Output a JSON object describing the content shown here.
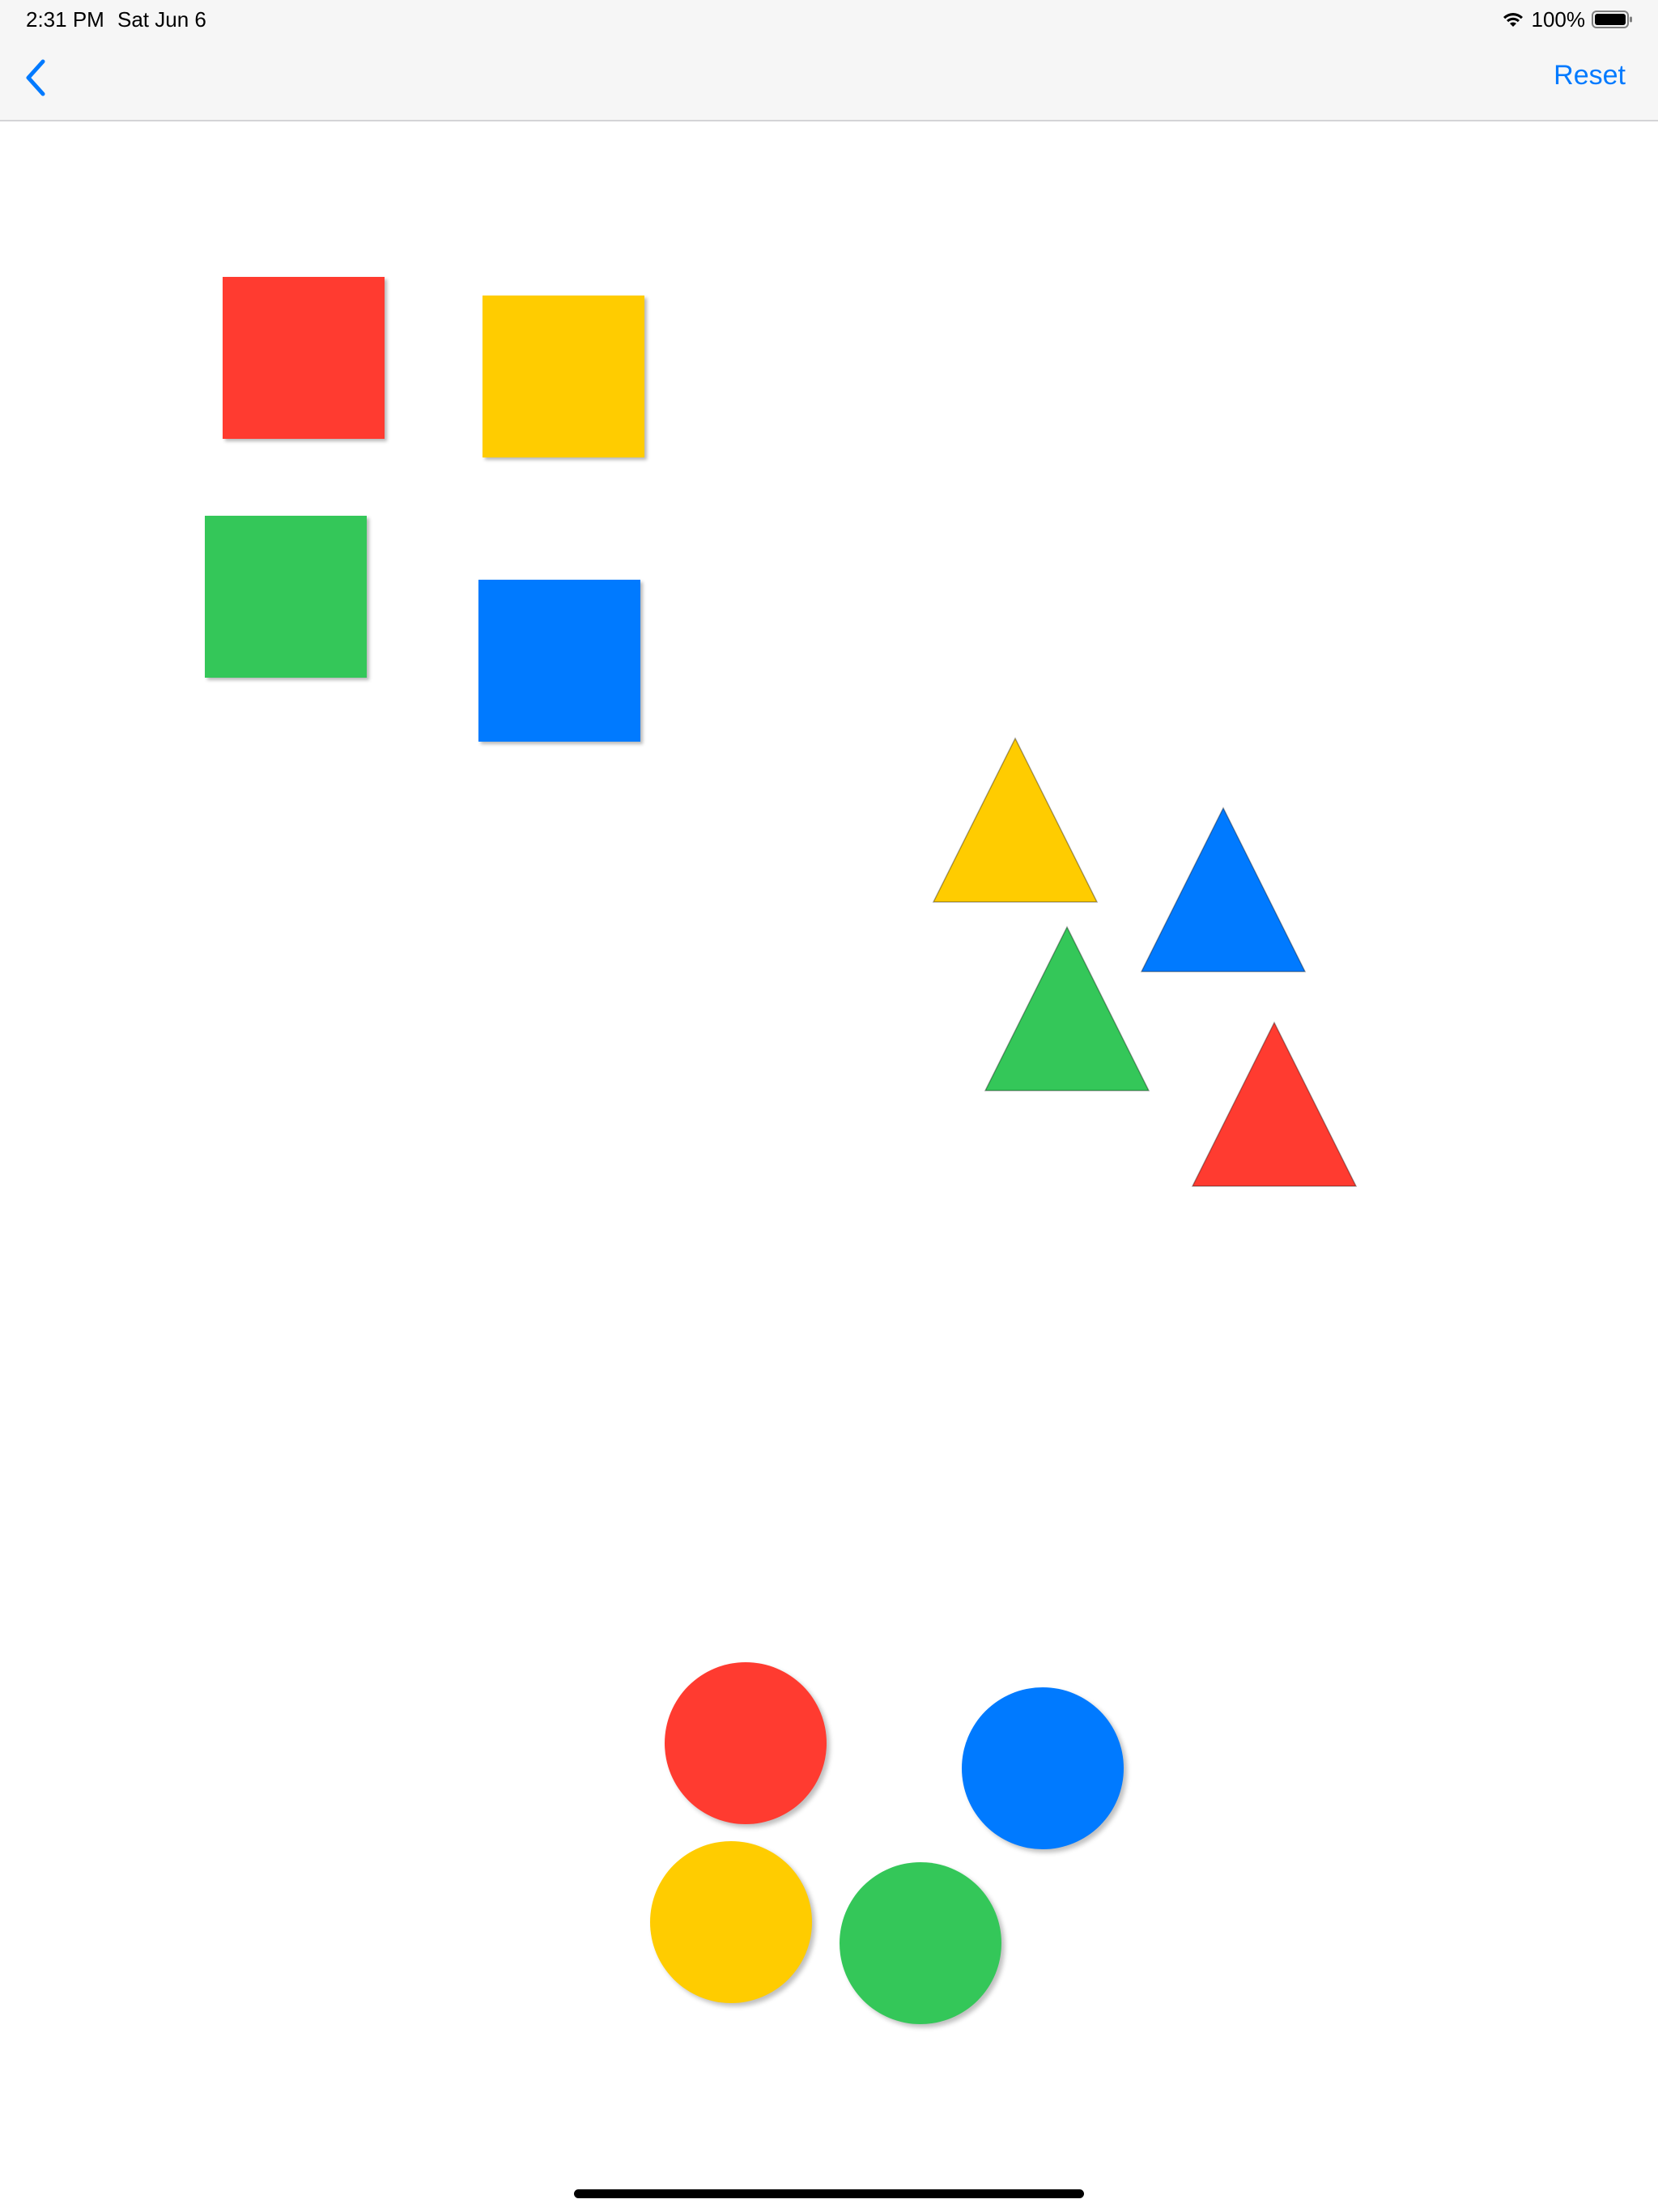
{
  "status_bar": {
    "time": "2:31 PM",
    "date": "Sat Jun 6",
    "battery": "100%"
  },
  "nav": {
    "back_icon": "chevron-left-icon",
    "reset_label": "Reset"
  },
  "colors": {
    "red": "#ff3b30",
    "yellow": "#ffcc00",
    "green": "#34c759",
    "blue": "#007aff",
    "accent": "#007aff"
  },
  "shapes": {
    "squares": [
      "red",
      "yellow",
      "green",
      "blue"
    ],
    "triangles": [
      "yellow",
      "blue",
      "green",
      "red"
    ],
    "circles": [
      "red",
      "blue",
      "yellow",
      "green"
    ]
  }
}
